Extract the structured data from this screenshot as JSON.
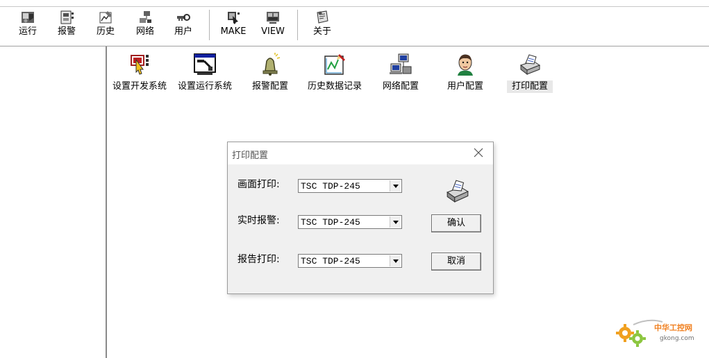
{
  "toolbar": {
    "buttons": [
      {
        "label": "运行",
        "icon": "run-icon"
      },
      {
        "label": "报警",
        "icon": "alarm-icon"
      },
      {
        "label": "历史",
        "icon": "history-icon"
      },
      {
        "label": "网络",
        "icon": "network-icon"
      },
      {
        "label": "用户",
        "icon": "user-key-icon"
      },
      {
        "label": "MAKE",
        "icon": "make-icon"
      },
      {
        "label": "VIEW",
        "icon": "view-icon"
      },
      {
        "label": "关于",
        "icon": "about-icon"
      }
    ]
  },
  "config_items": [
    {
      "label": "设置开发系统",
      "icon": "dev-system-icon"
    },
    {
      "label": "设置运行系统",
      "icon": "run-system-icon"
    },
    {
      "label": "报警配置",
      "icon": "alarm-bell-icon"
    },
    {
      "label": "历史数据记录",
      "icon": "history-data-icon"
    },
    {
      "label": "网络配置",
      "icon": "network-computers-icon"
    },
    {
      "label": "用户配置",
      "icon": "user-avatar-icon"
    },
    {
      "label": "打印配置",
      "icon": "printer-icon",
      "selected": true
    }
  ],
  "dialog": {
    "title": "打印配置",
    "rows": [
      {
        "label": "画面打印:",
        "value": "TSC TDP-245"
      },
      {
        "label": "实时报警:",
        "value": "TSC TDP-245"
      },
      {
        "label": "报告打印:",
        "value": "TSC TDP-245"
      }
    ],
    "ok_label": "确认",
    "cancel_label": "取消"
  },
  "watermark": {
    "brand": "中华工控网",
    "site": "gkong.com"
  },
  "colors": {
    "accent_orange": "#f0a020",
    "watermark_green": "#8cc63f",
    "dialog_bg": "#f0f0f0"
  }
}
